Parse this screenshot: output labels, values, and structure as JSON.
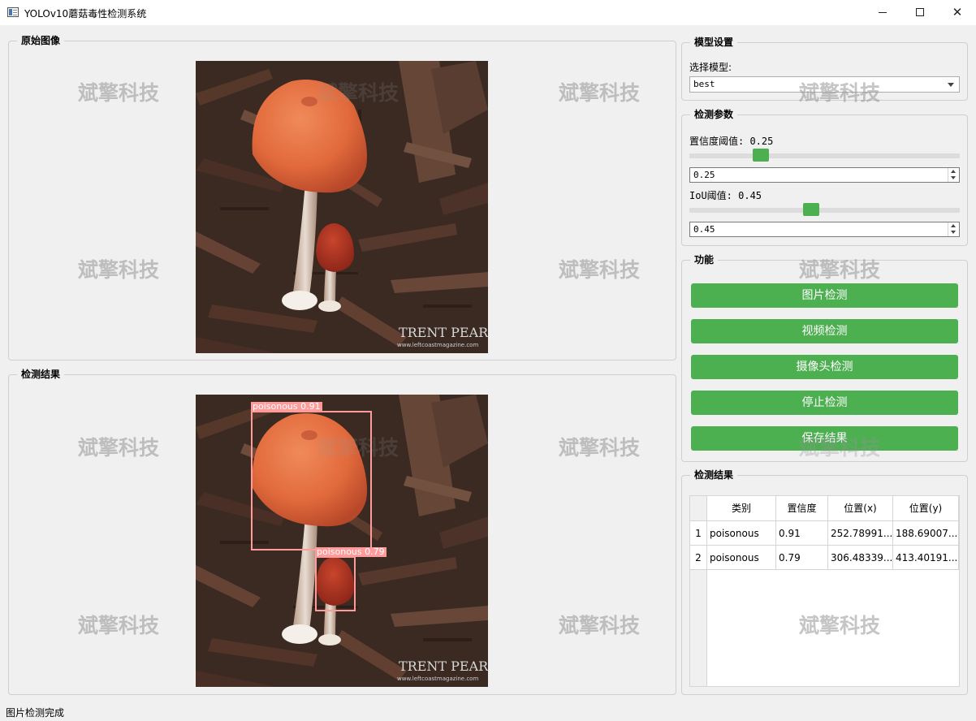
{
  "window": {
    "title": "YOLOv10蘑菇毒性检测系统",
    "minimize_icon": "minimize-icon",
    "maximize_icon": "maximize-icon",
    "close_icon": "close-icon"
  },
  "watermark": "斌擎科技",
  "original_group": {
    "title": "原始图像"
  },
  "result_image_group": {
    "title": "检测结果"
  },
  "detections": [
    {
      "label": "poisonous  0.91"
    },
    {
      "label": "poisonous  0.79"
    }
  ],
  "photo_text": {
    "credit": "TRENT PEARCE",
    "url": "www.leftcoastmagazine.com"
  },
  "model_group": {
    "title": "模型设置",
    "select_label": "选择模型:",
    "selected_model": "best"
  },
  "params_group": {
    "title": "检测参数",
    "conf_label": "置信度阈值: 0.25",
    "conf_value": "0.25",
    "conf_level": 0.25,
    "iou_label": "IoU阈值: 0.45",
    "iou_value": "0.45",
    "iou_level": 0.45
  },
  "function_group": {
    "title": "功能",
    "buttons": [
      "图片检测",
      "视频检测",
      "摄像头检测",
      "停止检测",
      "保存结果"
    ],
    "button_color": "#4caf50"
  },
  "results_group": {
    "title": "检测结果",
    "columns": [
      "类别",
      "置信度",
      "位置(x)",
      "位置(y)"
    ],
    "rows": [
      {
        "index": "1",
        "cls": "poisonous",
        "conf": "0.91",
        "x": "252.78991...",
        "y": "188.69007..."
      },
      {
        "index": "2",
        "cls": "poisonous",
        "conf": "0.79",
        "x": "306.48339...",
        "y": "413.40191..."
      }
    ]
  },
  "status_bar": {
    "text": "图片检测完成"
  }
}
